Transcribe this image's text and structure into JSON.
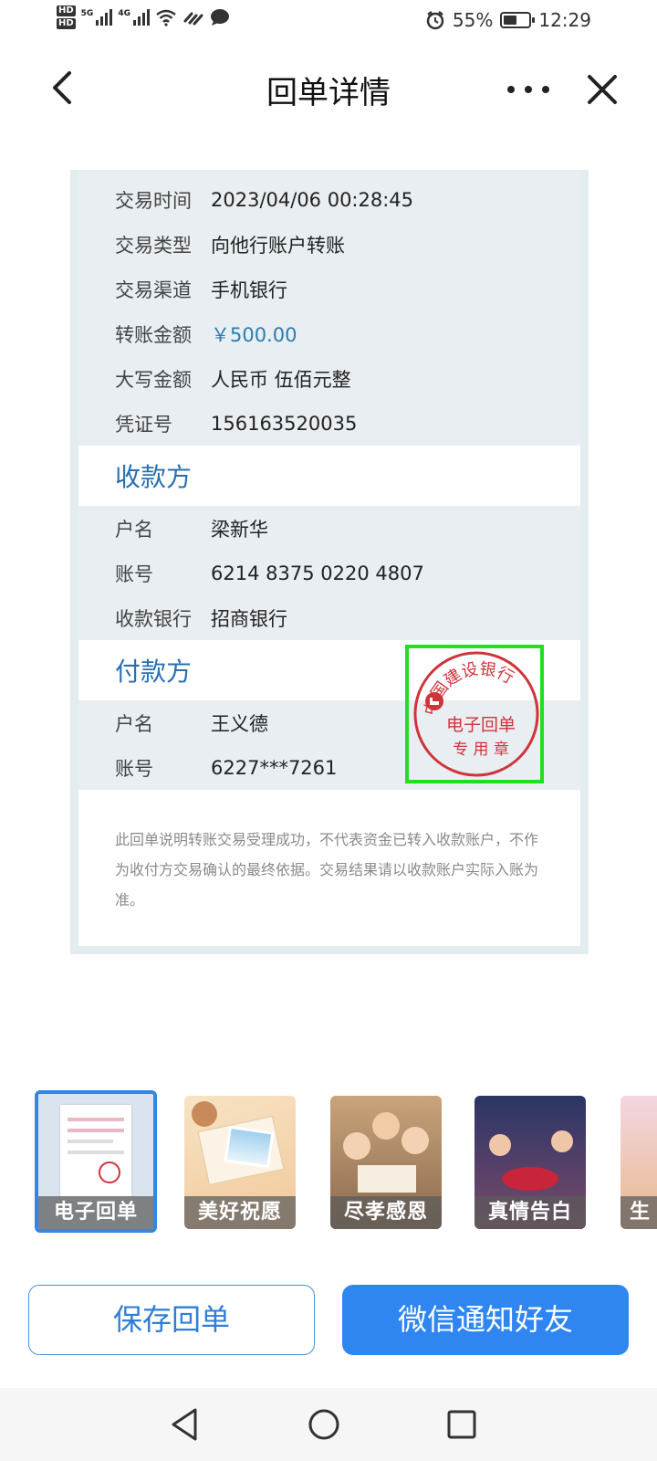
{
  "status_bar": {
    "hd1": "HD",
    "hd2": "HD",
    "net1": "5G",
    "net2": "4G",
    "battery_percent": "55%",
    "battery_level": 0.55,
    "time": "12:29"
  },
  "header": {
    "title": "回单详情"
  },
  "transaction": {
    "rows": [
      {
        "label": "交易时间",
        "value": "2023/04/06 00:28:45"
      },
      {
        "label": "交易类型",
        "value": "向他行账户转账"
      },
      {
        "label": "交易渠道",
        "value": "手机银行"
      },
      {
        "label": "转账金额",
        "value": "￥500.00"
      },
      {
        "label": "大写金额",
        "value": "人民币 伍佰元整"
      },
      {
        "label": "凭证号",
        "value": "156163520035"
      }
    ]
  },
  "payee": {
    "title": "收款方",
    "rows": [
      {
        "label": "户名",
        "value": "梁新华"
      },
      {
        "label": "账号",
        "value": "6214 8375 0220 4807"
      },
      {
        "label": "收款银行",
        "value": "招商银行"
      }
    ]
  },
  "payer": {
    "title": "付款方",
    "rows": [
      {
        "label": "户名",
        "value": "王义德"
      },
      {
        "label": "账号",
        "value": "6227***7261"
      }
    ]
  },
  "notice": "此回单说明转账交易受理成功，不代表资金已转入收款账户，不作为收付方交易确认的最终依据。交易结果请以收款账户实际入账为准。",
  "stamp": {
    "bank": "中国建设银行",
    "line1": "电子回单",
    "line2": "专 用 章"
  },
  "templates": [
    {
      "label": "电子回单",
      "selected": true
    },
    {
      "label": "美好祝愿",
      "selected": false
    },
    {
      "label": "尽孝感恩",
      "selected": false
    },
    {
      "label": "真情告白",
      "selected": false
    },
    {
      "label": "生",
      "selected": false
    }
  ],
  "buttons": {
    "save": "保存回单",
    "wechat": "微信通知好友"
  },
  "colors": {
    "accent": "#2f86f0",
    "section_title": "#2a6fb2",
    "amount": "#2c7dae",
    "stamp": "#d0343a",
    "highlight": "#22dd22"
  }
}
